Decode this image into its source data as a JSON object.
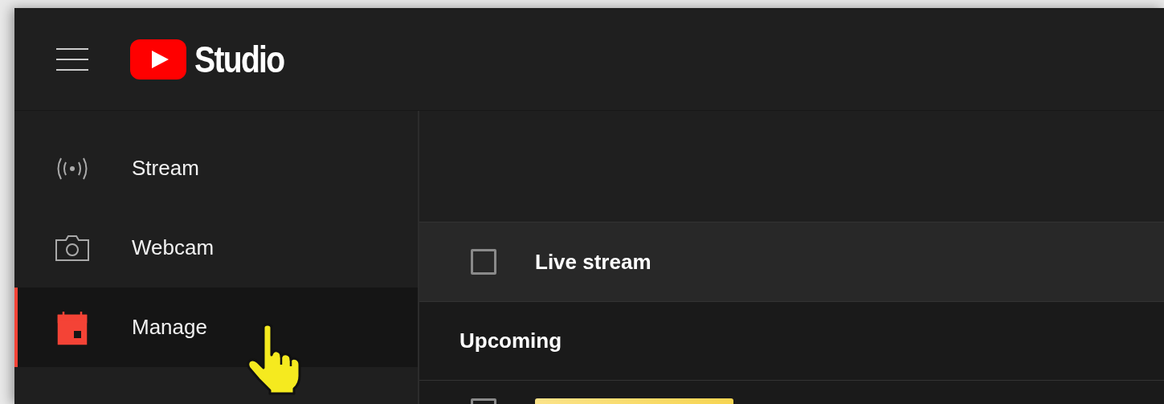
{
  "header": {
    "logo_text": "Studio"
  },
  "sidebar": {
    "items": [
      {
        "kind": "stream",
        "label": "Stream",
        "selected": false
      },
      {
        "kind": "webcam",
        "label": "Webcam",
        "selected": false
      },
      {
        "kind": "manage",
        "label": "Manage",
        "selected": true
      }
    ]
  },
  "table": {
    "header": {
      "checked": false,
      "label": "Live stream"
    },
    "section": "Upcoming",
    "rows": [
      {
        "checked": false
      }
    ]
  }
}
